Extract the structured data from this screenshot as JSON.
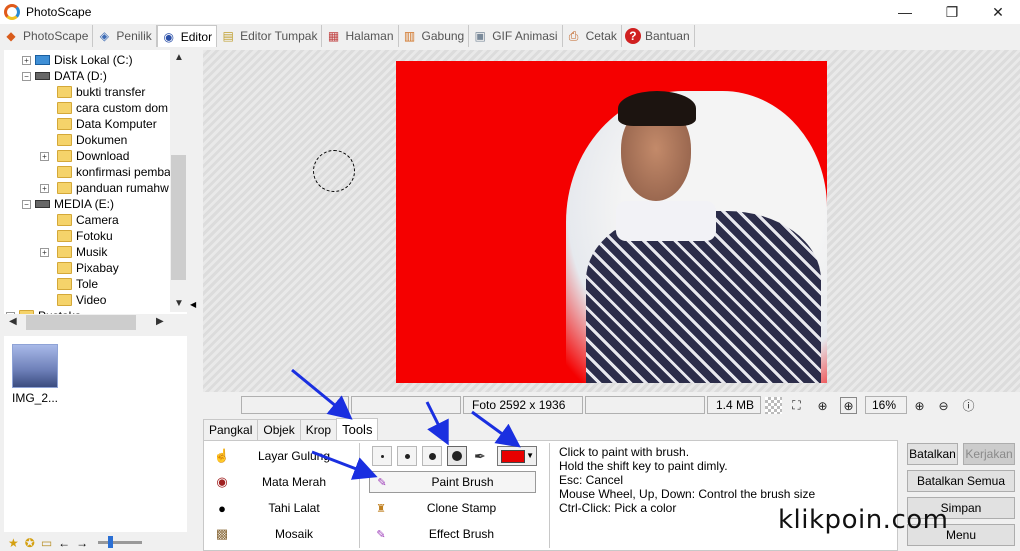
{
  "window": {
    "title": "PhotoScape",
    "minimize_glyph": "—",
    "maximize_glyph": "❐",
    "close_glyph": "✕"
  },
  "main_tabs": [
    {
      "label": "PhotoScape",
      "icon": "photoscape-icon",
      "glyph": "◆"
    },
    {
      "label": "Penilik",
      "icon": "viewer-icon",
      "glyph": "◈"
    },
    {
      "label": "Editor",
      "icon": "editor-icon",
      "glyph": "◉"
    },
    {
      "label": "Editor Tumpak",
      "icon": "batch-editor-icon",
      "glyph": "▤"
    },
    {
      "label": "Halaman",
      "icon": "page-icon",
      "glyph": "▦"
    },
    {
      "label": "Gabung",
      "icon": "combine-icon",
      "glyph": "▥"
    },
    {
      "label": "GIF Animasi",
      "icon": "gif-icon",
      "glyph": "▣"
    },
    {
      "label": "Cetak",
      "icon": "print-icon",
      "glyph": "⎙"
    },
    {
      "label": "Bantuan",
      "icon": "help-icon",
      "glyph": "?"
    }
  ],
  "active_main_tab": "Editor",
  "tree": [
    {
      "label": "Disk Lokal (C:)",
      "type": "drive-blue",
      "level": 1,
      "expander": "+"
    },
    {
      "label": "DATA (D:)",
      "type": "drive",
      "level": 1,
      "expander": "−"
    },
    {
      "label": "bukti transfer",
      "type": "folder",
      "level": 2,
      "expander": ""
    },
    {
      "label": "cara custom dom",
      "type": "folder",
      "level": 2,
      "expander": ""
    },
    {
      "label": "Data Komputer",
      "type": "folder",
      "level": 2,
      "expander": ""
    },
    {
      "label": "Dokumen",
      "type": "folder",
      "level": 2,
      "expander": ""
    },
    {
      "label": "Download",
      "type": "folder",
      "level": 2,
      "expander": "+"
    },
    {
      "label": "konfirmasi pemba",
      "type": "folder",
      "level": 2,
      "expander": ""
    },
    {
      "label": "panduan rumahw",
      "type": "folder",
      "level": 2,
      "expander": "+"
    },
    {
      "label": "MEDIA (E:)",
      "type": "drive",
      "level": 1,
      "expander": "−"
    },
    {
      "label": "Camera",
      "type": "folder",
      "level": 2,
      "expander": ""
    },
    {
      "label": "Fotoku",
      "type": "folder",
      "level": 2,
      "expander": ""
    },
    {
      "label": "Musik",
      "type": "folder",
      "level": 2,
      "expander": "+"
    },
    {
      "label": "Pixabay",
      "type": "folder",
      "level": 2,
      "expander": ""
    },
    {
      "label": "Tole",
      "type": "folder",
      "level": 2,
      "expander": ""
    },
    {
      "label": "Video",
      "type": "folder",
      "level": 2,
      "expander": ""
    },
    {
      "label": "Pustaka",
      "type": "folder",
      "level": 0,
      "expander": "+"
    }
  ],
  "thumbnail": {
    "caption": "IMG_2..."
  },
  "status": {
    "photo_size": "Foto 2592 x 1936",
    "file_size": "1.4 MB",
    "zoom": "16%"
  },
  "editor_tabs": [
    "Pangkal",
    "Objek",
    "Krop",
    "Tools"
  ],
  "active_editor_tab": "Tools",
  "left_tools": [
    {
      "label": "Layar Gulung",
      "icon": "hand-icon",
      "glyph": "☝"
    },
    {
      "label": "Mata Merah",
      "icon": "red-eye-icon",
      "glyph": "◉"
    },
    {
      "label": "Tahi Lalat",
      "icon": "mole-icon",
      "glyph": "●"
    },
    {
      "label": "Mosaik",
      "icon": "mosaic-icon",
      "glyph": "▩"
    }
  ],
  "brush_tools": [
    {
      "label": "Paint Brush",
      "icon": "paint-brush-icon",
      "glyph": "✎",
      "selected": true
    },
    {
      "label": "Clone Stamp",
      "icon": "clone-stamp-icon",
      "glyph": "♜",
      "selected": false
    },
    {
      "label": "Effect Brush",
      "icon": "effect-brush-icon",
      "glyph": "✎",
      "selected": false
    }
  ],
  "brush_color": "#e80000",
  "dropdown_glyph": "▼",
  "help_lines": [
    "Click to paint with brush.",
    "Hold the shift key to paint dimly.",
    "Esc: Cancel",
    "Mouse Wheel, Up, Down: Control the brush size",
    "Ctrl-Click: Pick a color"
  ],
  "buttons": {
    "undo": "Batalkan",
    "redo": "Kerjakan",
    "undo_all": "Batalkan Semua",
    "save": "Simpan",
    "menu": "Menu"
  },
  "watermark": "klikpoin.com"
}
